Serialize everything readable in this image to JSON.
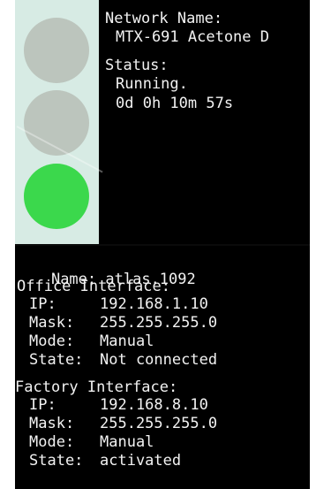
{
  "status_panel": {
    "network_name_label": "Network Name:",
    "network_name_value": "MTX-691 Acetone D",
    "status_label": "Status:",
    "status_value": "Running.",
    "uptime": "0d 0h 10m 57s"
  },
  "traffic_light": {
    "active": "green",
    "colors": {
      "red_off": "#bcc5bd",
      "yellow_off": "#bcc5bd",
      "green_on": "#3bd84c"
    }
  },
  "device": {
    "name_label": "Name:",
    "name_value": "atlas.1092"
  },
  "office": {
    "title": "Office Interface:",
    "ip_label": "IP:",
    "ip_value": "192.168.1.10",
    "mask_label": "Mask:",
    "mask_value": "255.255.255.0",
    "mode_label": "Mode:",
    "mode_value": "Manual",
    "state_label": "State:",
    "state_value": "Not connected"
  },
  "factory": {
    "title": "Factory Interface:",
    "ip_label": "IP:",
    "ip_value": "192.168.8.10",
    "mask_label": "Mask:",
    "mask_value": "255.255.255.0",
    "mode_label": "Mode:",
    "mode_value": "Manual",
    "state_label": "State:",
    "state_value": "activated"
  }
}
